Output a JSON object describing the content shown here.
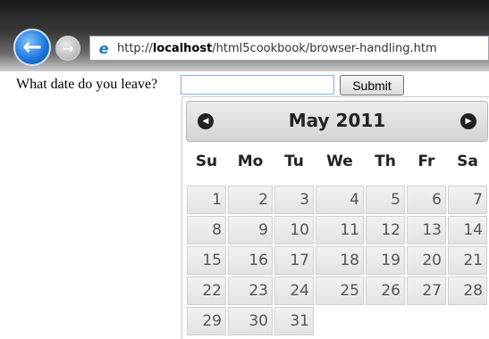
{
  "browser": {
    "back_icon": "back-arrow-icon",
    "forward_icon": "forward-arrow-icon",
    "ie_icon": "ie-logo-icon",
    "url_prefix": "http://",
    "url_host": "localhost",
    "url_path": "/html5cookbook/browser-handling.htm"
  },
  "form": {
    "question": "What date do you leave?",
    "date_value": "",
    "submit_label": "Submit"
  },
  "calendar": {
    "month_title": "May 2011",
    "prev_icon": "chevron-left-icon",
    "next_icon": "chevron-right-icon",
    "weekdays": [
      "Su",
      "Mo",
      "Tu",
      "We",
      "Th",
      "Fr",
      "Sa"
    ],
    "days": [
      "1",
      "2",
      "3",
      "4",
      "5",
      "6",
      "7",
      "8",
      "9",
      "10",
      "11",
      "12",
      "13",
      "14",
      "15",
      "16",
      "17",
      "18",
      "19",
      "20",
      "21",
      "22",
      "23",
      "24",
      "25",
      "26",
      "27",
      "28",
      "29",
      "30",
      "31"
    ]
  }
}
